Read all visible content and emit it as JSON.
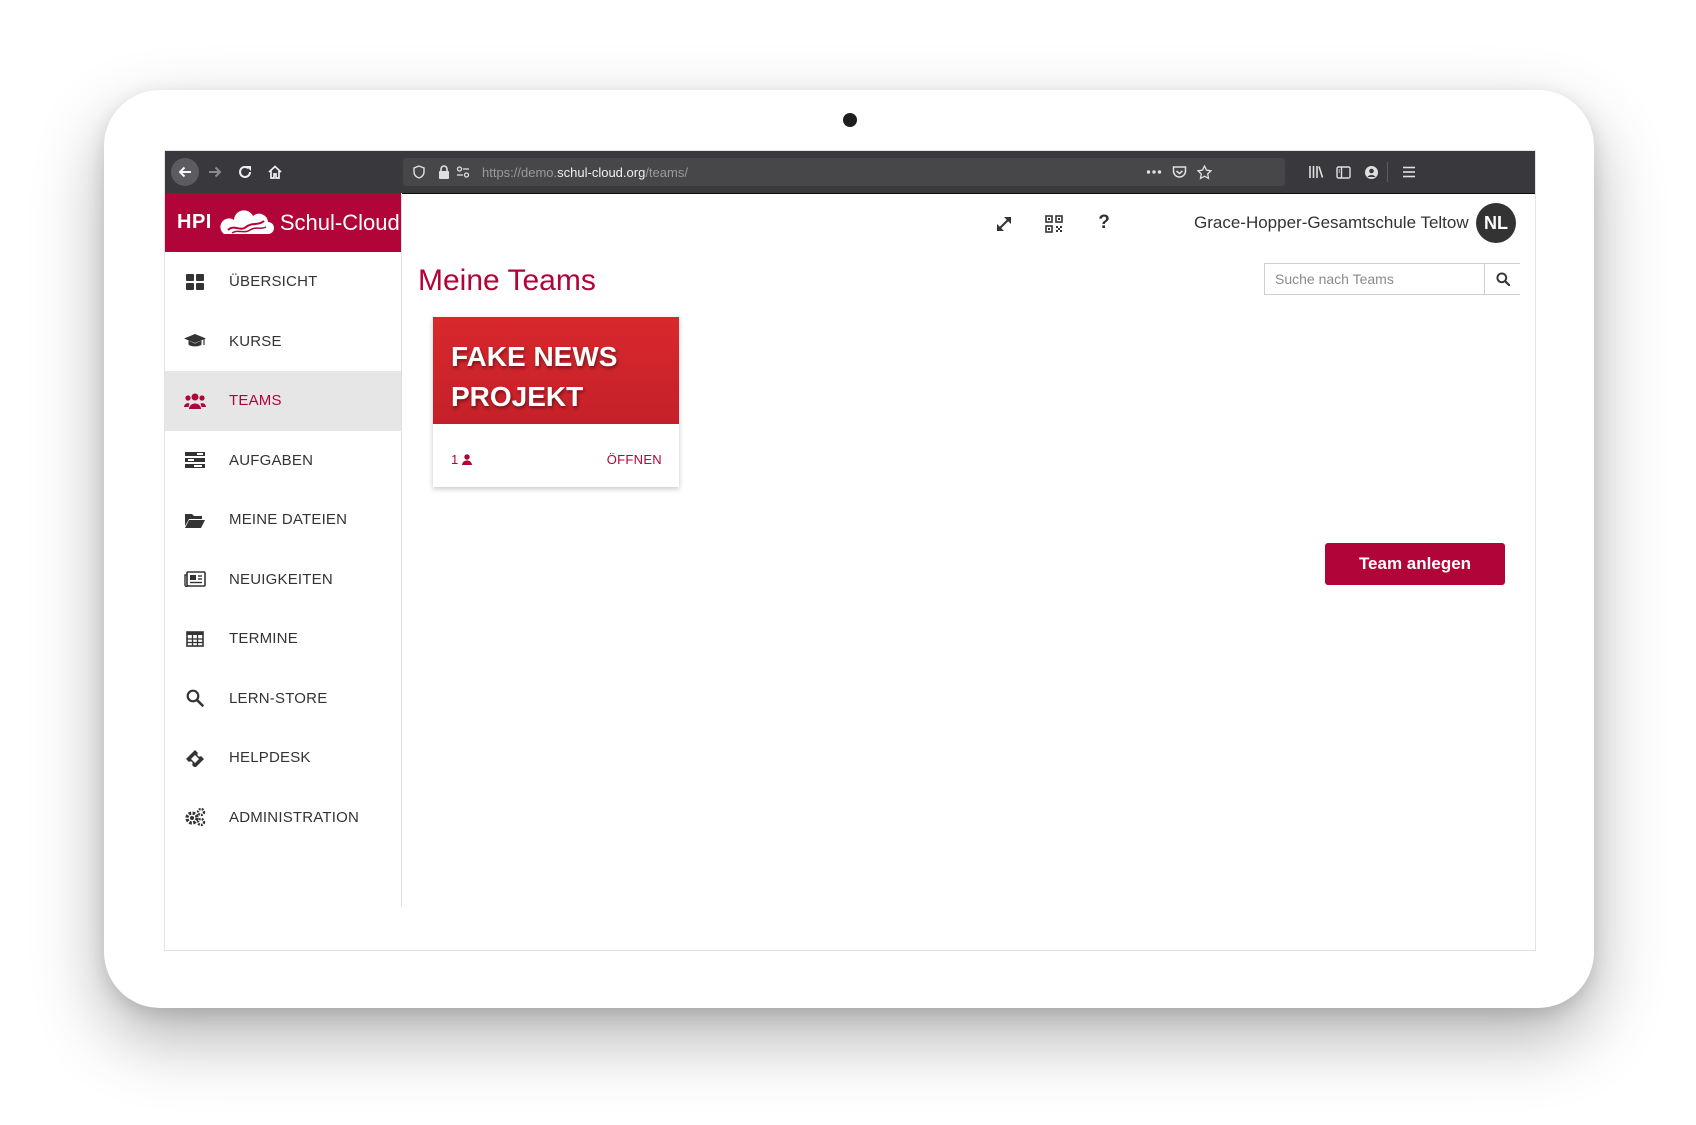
{
  "browser": {
    "url_prefix": "https://demo.",
    "url_domain": "schul-cloud.org",
    "url_path": "/teams/"
  },
  "brand": {
    "logo_text": "HPI",
    "name": "Schul-Cloud",
    "color": "#b10438"
  },
  "sidebar": {
    "items": [
      {
        "label": "ÜBERSICHT",
        "icon": "dashboard-icon",
        "active": false
      },
      {
        "label": "KURSE",
        "icon": "graduation-cap-icon",
        "active": false
      },
      {
        "label": "TEAMS",
        "icon": "users-icon",
        "active": true
      },
      {
        "label": "AUFGABEN",
        "icon": "tasks-icon",
        "active": false
      },
      {
        "label": "MEINE DATEIEN",
        "icon": "folder-open-icon",
        "active": false
      },
      {
        "label": "NEUIGKEITEN",
        "icon": "newspaper-icon",
        "active": false
      },
      {
        "label": "TERMINE",
        "icon": "calendar-table-icon",
        "active": false
      },
      {
        "label": "LERN-STORE",
        "icon": "search-icon",
        "active": false
      },
      {
        "label": "HELPDESK",
        "icon": "ticket-icon",
        "active": false
      },
      {
        "label": "ADMINISTRATION",
        "icon": "cogs-icon",
        "active": false
      }
    ]
  },
  "topbar": {
    "school": "Grace-Hopper-Gesamtschule Teltow",
    "avatar_initials": "NL",
    "help_label": "?"
  },
  "main": {
    "title": "Meine Teams",
    "search_placeholder": "Suche nach Teams",
    "teams": [
      {
        "title": "FAKE NEWS PROJEKT",
        "member_count": "1",
        "open_label": "ÖFFNEN"
      }
    ],
    "create_button": "Team anlegen"
  }
}
